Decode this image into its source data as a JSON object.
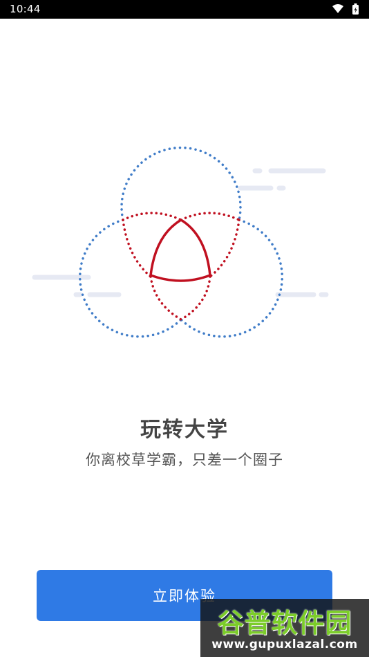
{
  "status_bar": {
    "time": "10:44",
    "icons": [
      "wifi-icon",
      "battery-charging-icon"
    ]
  },
  "illustration": {
    "blue_color": "#3f7cc8",
    "red_color": "#c01020",
    "line_color": "#e6e9f3"
  },
  "content": {
    "title": "玩转大学",
    "subtitle": "你离校草学霸，只差一个圈子"
  },
  "cta": {
    "label": "立即体验",
    "color": "#2f7ae5"
  },
  "watermark": {
    "brand": "谷普软件园",
    "url": "www.gupuxlazal.com"
  }
}
